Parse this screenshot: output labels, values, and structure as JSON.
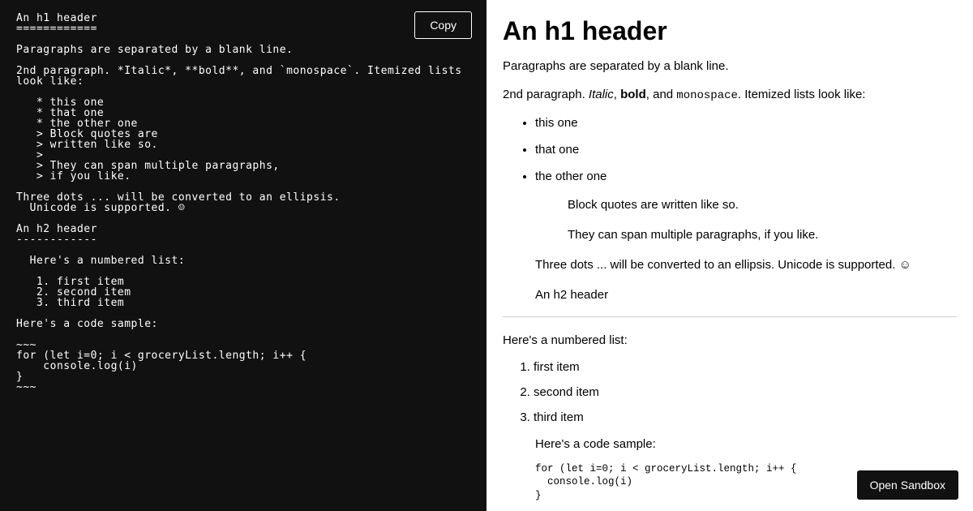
{
  "left": {
    "copy_label": "Copy",
    "code": "An h1 header\n============\n\nParagraphs are separated by a blank line.\n\n2nd paragraph. *Italic*, **bold**, and `monospace`. Itemized lists\nlook like:\n\n   * this one\n   * that one\n   * the other one\n   > Block quotes are\n   > written like so.\n   >\n   > They can span multiple paragraphs,\n   > if you like.\n\nThree dots ... will be converted to an ellipsis.\n  Unicode is supported. ☺\n\nAn h2 header\n------------\n\n  Here's a numbered list:\n\n   1. first item\n   2. second item\n   3. third item\n\nHere's a code sample:\n\n~~~\nfor (let i=0; i < groceryList.length; i++ {\n    console.log(i)\n}\n~~~"
  },
  "right": {
    "h1": "An h1 header",
    "p1": "Paragraphs are separated by a blank line.",
    "p2_prefix": "2nd paragraph. ",
    "italic": "Italic",
    "sep1": ", ",
    "bold": "bold",
    "sep2": ", and ",
    "mono": "monospace",
    "p2_suffix": ". Itemized lists look like:",
    "li1": "this one",
    "li2": "that one",
    "li3": "the other one",
    "bq1": "Block quotes are written like so.",
    "bq2": "They can span multiple paragraphs, if you like.",
    "ellipsis": "Three dots ... will be converted to an ellipsis. Unicode is supported. ☺",
    "h2": "An h2 header",
    "numbered_intro": "Here's a numbered list:",
    "ol1": "first item",
    "ol2": "second item",
    "ol3": "third item",
    "code_intro": "Here's a code sample:",
    "code_sample": "for (let i=0; i < groceryList.length; i++ {\n  console.log(i)\n}",
    "sandbox_label": "Open Sandbox"
  }
}
